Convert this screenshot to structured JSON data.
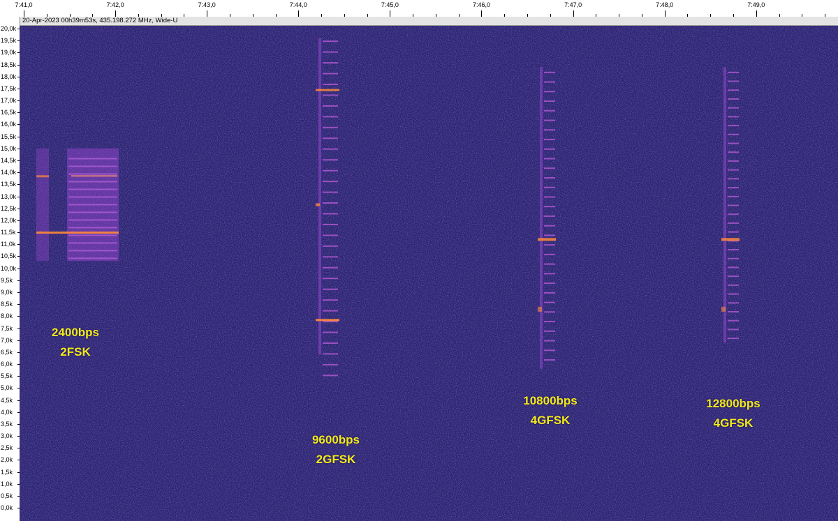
{
  "time_ruler": {
    "labels": [
      "7:41,0",
      "7:42,0",
      "7:43,0",
      "7:44,0",
      "7:45,0",
      "7:46,0",
      "7:47,0",
      "7:48,0",
      "7:49,0"
    ]
  },
  "info_bar": {
    "text": "20-Apr-2023 00h39m53s, 435.198.272 MHz, Wide-U"
  },
  "freq_axis": {
    "labels": [
      "20,0k",
      "19,5k",
      "19,0k",
      "18,5k",
      "18,0k",
      "17,5k",
      "17,0k",
      "16,5k",
      "16,0k",
      "15,5k",
      "15,0k",
      "14,5k",
      "14,0k",
      "13,5k",
      "13,0k",
      "12,5k",
      "12,0k",
      "11,5k",
      "11,0k",
      "10,5k",
      "10,0k",
      "9,5k",
      "9,0k",
      "8,5k",
      "8,0k",
      "7,5k",
      "7,0k",
      "6,5k",
      "6,0k",
      "5,5k",
      "5,0k",
      "4,5k",
      "4,0k",
      "3,5k",
      "3,0k",
      "2,5k",
      "2,0k",
      "1,5k",
      "1,0k",
      "0,5k",
      "0,0k"
    ]
  },
  "spectrogram": {
    "background_color": "#2a2370",
    "signal_color": "#a04ad8",
    "hot_color": "#ff8a3a"
  },
  "annotations": [
    {
      "line1": "2400bps",
      "line2": "2FSK"
    },
    {
      "line1": "9600bps",
      "line2": "2GFSK"
    },
    {
      "line1": "10800bps",
      "line2": "4GFSK"
    },
    {
      "line1": "12800bps",
      "line2": "4GFSK"
    }
  ]
}
